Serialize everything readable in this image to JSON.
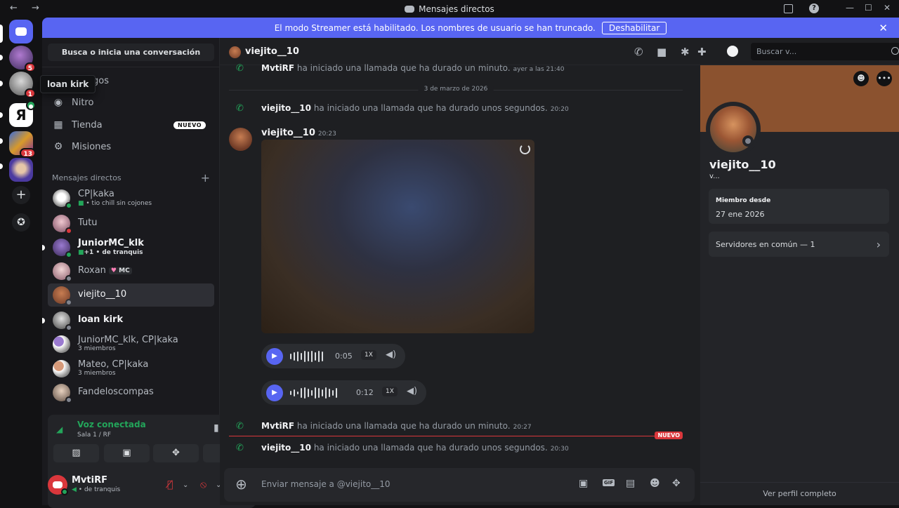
{
  "window": {
    "title": "Mensajes directos",
    "nav_arrows": "← →"
  },
  "banner": {
    "text": "El modo Streamer está habilitado. Los nombres de usuario se han truncado.",
    "button": "Deshabilitar",
    "close": "✕"
  },
  "guilds": {
    "badges": [
      "5",
      "1",
      "13"
    ],
    "tooltip": "loan kirk"
  },
  "sidebar": {
    "search_label": "Busca o inicia una conversación",
    "nav": [
      {
        "label": "gos",
        "icon": "friends-icon"
      },
      {
        "label": "Nitro",
        "icon": "nitro-icon"
      },
      {
        "label": "Tienda",
        "icon": "store-icon",
        "badge": "NUEVO"
      },
      {
        "label": "Misiones",
        "icon": "quests-icon"
      }
    ],
    "dm_header": "Mensajes directos",
    "dms": [
      {
        "name": "CP|kaka",
        "sub": "• tio chill sin cojones"
      },
      {
        "name": "Tutu"
      },
      {
        "name": "JuniorMC_klk",
        "sub": "+1 •  de tranquis"
      },
      {
        "name": "Roxan",
        "tag": "MC"
      },
      {
        "name": "viejito__10"
      },
      {
        "name": "loan kirk"
      },
      {
        "name": "JuniorMC_klk, CP|kaka",
        "sub": "3 miembros"
      },
      {
        "name": "Mateo, CP|kaka",
        "sub": "3 miembros"
      },
      {
        "name": "Fandeloscompas"
      }
    ]
  },
  "voice": {
    "title": "Voz conectada",
    "sub": "Sala 1 / RF"
  },
  "user": {
    "name": "MvtiRF",
    "sub": "•  de tranquis"
  },
  "chat": {
    "header_name": "viejito__10",
    "search_placeholder": "Buscar v...",
    "date_separator": "3 de marzo de 2026",
    "messages": [
      {
        "who": "MvtiRF",
        "text": "ha iniciado una llamada que ha durado un minuto.",
        "time": "ayer a las 21:40"
      },
      {
        "who": "viejito__10",
        "text": "ha iniciado una llamada que ha durado unos segundos.",
        "time": "20:20"
      },
      {
        "who": "MvtiRF",
        "text": "ha iniciado una llamada que ha durado un minuto.",
        "time": "20:27"
      },
      {
        "who": "viejito__10",
        "text": "ha iniciado una llamada que ha durado unos segundos.",
        "time": "20:30"
      }
    ],
    "post": {
      "author": "viejito__10",
      "time": "20:23"
    },
    "voice_messages": [
      {
        "duration": "0:05",
        "speed": "1X"
      },
      {
        "duration": "0:12",
        "speed": "1X"
      }
    ],
    "new_label": "NUEVO",
    "composer_placeholder": "Enviar mensaje a @viejito__10"
  },
  "profile": {
    "name": "viejito__10",
    "username": "v...",
    "member_since_label": "Miembro desde",
    "member_since": "27 ene 2026",
    "servers_common": "Servidores en común — 1",
    "view_full": "Ver perfil completo"
  },
  "colors": {
    "accent": "#5865f2",
    "online": "#23a55a",
    "danger": "#da373c",
    "profile_banner": "#8b522f"
  }
}
